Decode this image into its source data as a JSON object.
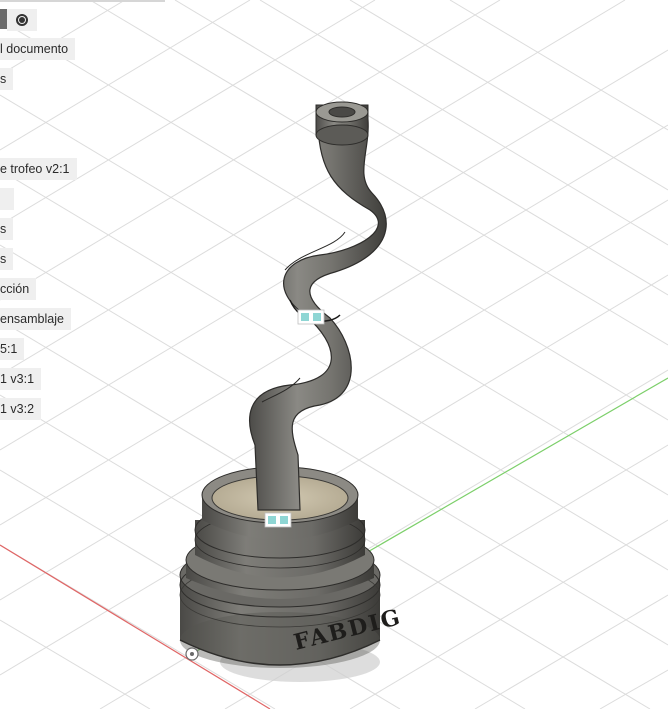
{
  "browser": {
    "items": [
      "l documento",
      "s",
      "e trofeo v2:1",
      "",
      "s",
      "s",
      "cción",
      " ensamblaje",
      "5:1",
      "1 v3:1",
      "1 v3:2"
    ]
  },
  "model": {
    "engraving": "FABDIG"
  },
  "colors": {
    "background": "#ffffff",
    "grid": "#d9d9d9",
    "axis_x": "#e06666",
    "axis_y": "#7ccf6a",
    "model_body": "#6e6d69",
    "model_top": "#c8bea6",
    "joint_marker": "#8fd6d4"
  },
  "icons": [
    "visibility-radio-icon",
    "joint-icon",
    "origin-icon"
  ]
}
